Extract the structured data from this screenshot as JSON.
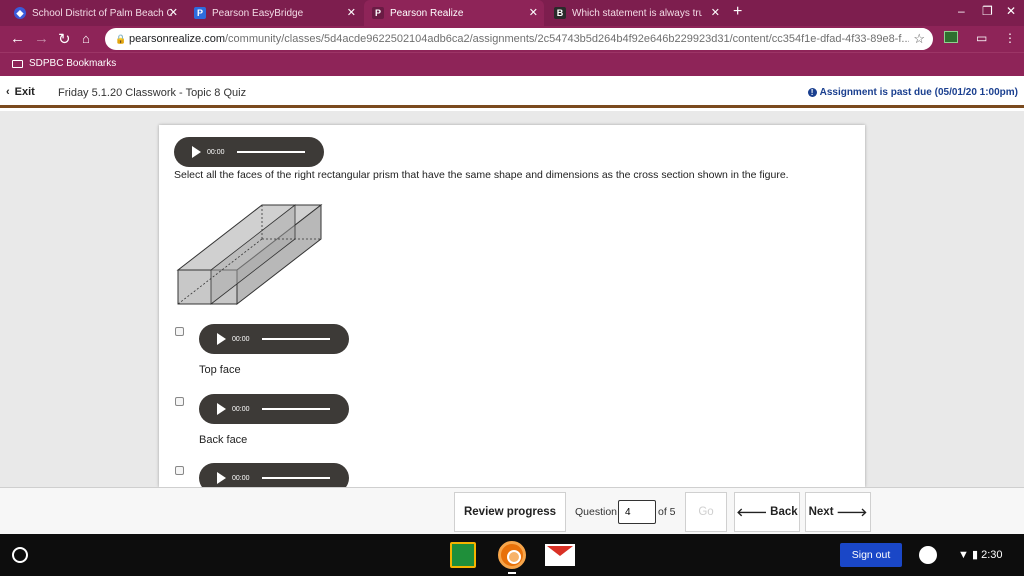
{
  "browser": {
    "tabs": [
      {
        "title": "School District of Palm Beach C",
        "favicon": "sdpbc-shield-icon",
        "color": "#3a5bd9",
        "active": false
      },
      {
        "title": "Pearson EasyBridge",
        "favicon": "P",
        "color": "#2d6cdf",
        "active": false
      },
      {
        "title": "Pearson Realize",
        "favicon": "P",
        "color": "#6a1b44",
        "active": true
      },
      {
        "title": "Which statement is always true?",
        "favicon": "B",
        "color": "#2a2a2a",
        "active": false
      }
    ],
    "tab_close_glyph": "✕",
    "new_tab_glyph": "+",
    "address": {
      "host": "pearsonrealize.com",
      "path": "/community/classes/5d4acde9622502104adb6ca2/assignments/2c54743b5d264b4f92e646b229923d31/content/cc354f1e-dfad-4f33-89e8-f..."
    },
    "bookmarks": [
      {
        "label": "SDPBC Bookmarks"
      }
    ],
    "theme_color": "#8e2458"
  },
  "header": {
    "exit_label": "Exit",
    "assignment_title": "Friday 5.1.20 Classwork - Topic 8 Quiz",
    "due_notice": "Assignment is past due (05/01/20 1:00pm)"
  },
  "question": {
    "audio_time": "00:00",
    "prompt": "Select all the faces of the right rectangular prism that have the same shape and dimensions as the cross section shown in the figure.",
    "options": [
      {
        "label": "Top face",
        "audio_time": "00:00",
        "checked": false
      },
      {
        "label": "Back face",
        "audio_time": "00:00",
        "checked": false
      },
      {
        "label": "",
        "audio_time": "00:00",
        "checked": false
      }
    ]
  },
  "nav": {
    "review_label": "Review progress",
    "question_label": "Question",
    "current_question": "4",
    "of_label": "of 5",
    "go_label": "Go",
    "back_label": "Back",
    "next_label": "Next"
  },
  "shelf": {
    "signout_label": "Sign out",
    "time": "2:30",
    "signout_color": "#1a47c7"
  }
}
